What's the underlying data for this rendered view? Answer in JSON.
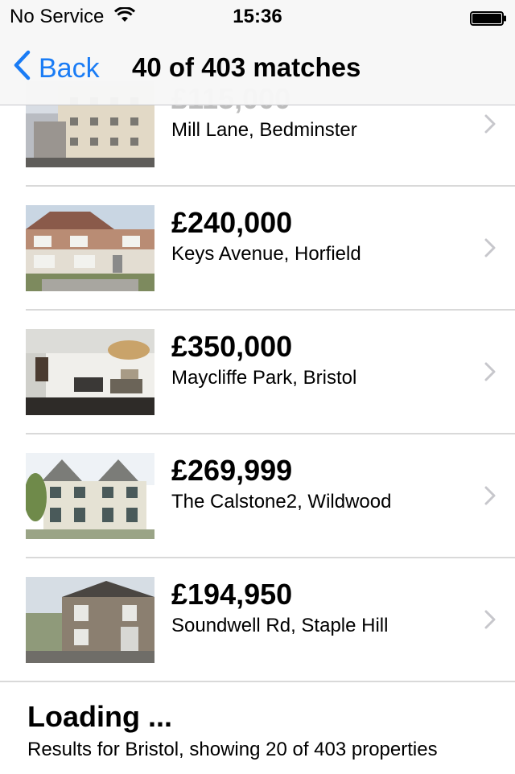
{
  "status_bar": {
    "carrier": "No Service",
    "time": "15:36"
  },
  "nav": {
    "back_label": "Back",
    "title": "40 of 403 matches"
  },
  "listings": [
    {
      "price": "£115,000",
      "address": "Mill Lane, Bedminster"
    },
    {
      "price": "£240,000",
      "address": "Keys Avenue, Horfield"
    },
    {
      "price": "£350,000",
      "address": "Maycliffe Park, Bristol"
    },
    {
      "price": "£269,999",
      "address": "The Calstone2, Wildwood"
    },
    {
      "price": "£194,950",
      "address": "Soundwell Rd, Staple Hill"
    }
  ],
  "footer": {
    "loading": "Loading ...",
    "results": "Results for Bristol, showing 20 of 403 properties"
  },
  "colors": {
    "accent": "#1a7cf5",
    "chevron": "#c7c7cc"
  }
}
